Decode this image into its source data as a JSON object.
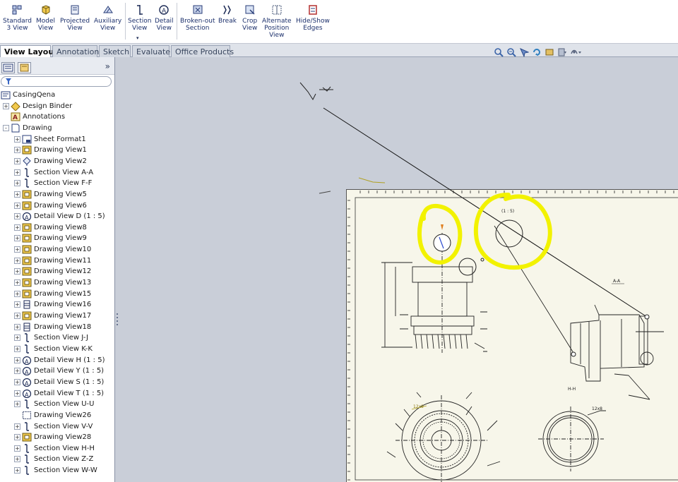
{
  "ribbon": {
    "buttons": [
      {
        "name": "standard-3-view-button",
        "line1": "Standard",
        "line2": "3 View",
        "line3": ""
      },
      {
        "name": "model-view-button",
        "line1": "Model",
        "line2": "View",
        "line3": ""
      },
      {
        "name": "projected-view-button",
        "line1": "Projected",
        "line2": "View",
        "line3": ""
      },
      {
        "name": "auxiliary-view-button",
        "line1": "Auxiliary",
        "line2": "View",
        "line3": ""
      },
      {
        "name": "section-view-button",
        "line1": "Section",
        "line2": "View",
        "line3": ""
      },
      {
        "name": "detail-view-button",
        "line1": "Detail",
        "line2": "View",
        "line3": ""
      },
      {
        "name": "broken-out-section-button",
        "line1": "Broken-out",
        "line2": "Section",
        "line3": ""
      },
      {
        "name": "break-button",
        "line1": "Break",
        "line2": "",
        "line3": ""
      },
      {
        "name": "crop-view-button",
        "line1": "Crop",
        "line2": "View",
        "line3": ""
      },
      {
        "name": "alternate-position-view-button",
        "line1": "Alternate",
        "line2": "Position",
        "line3": "View"
      },
      {
        "name": "hide-show-edges-button",
        "line1": "Hide/Show",
        "line2": "Edges",
        "line3": ""
      }
    ]
  },
  "tabs": [
    "View Layout",
    "Annotation",
    "Sketch",
    "Evaluate",
    "Office Products"
  ],
  "panel": {
    "expand_symbol": "»",
    "tree": [
      {
        "label": "CasingQena",
        "level": 0,
        "expander": "",
        "icon": "part-drawing-icon"
      },
      {
        "label": "Design Binder",
        "level": 1,
        "expander": "+",
        "icon": "design-binder-icon"
      },
      {
        "label": "Annotations",
        "level": 1,
        "expander": "",
        "icon": "annotations-icon"
      },
      {
        "label": "Drawing",
        "level": 1,
        "expander": "-",
        "icon": "sheet-icon"
      },
      {
        "label": "Sheet Format1",
        "level": 2,
        "expander": "+",
        "icon": "sheet-format-icon"
      },
      {
        "label": "Drawing View1",
        "level": 2,
        "expander": "+",
        "icon": "drawing-view-icon"
      },
      {
        "label": "Drawing View2",
        "level": 2,
        "expander": "+",
        "icon": "projected-view-icon"
      },
      {
        "label": "Section View A-A",
        "level": 2,
        "expander": "+",
        "icon": "section-view-icon"
      },
      {
        "label": "Section View F-F",
        "level": 2,
        "expander": "+",
        "icon": "section-view-icon"
      },
      {
        "label": "Drawing View5",
        "level": 2,
        "expander": "+",
        "icon": "drawing-view-icon"
      },
      {
        "label": "Drawing View6",
        "level": 2,
        "expander": "+",
        "icon": "drawing-view-icon"
      },
      {
        "label": "Detail View D (1 : 5)",
        "level": 2,
        "expander": "+",
        "icon": "detail-view-icon"
      },
      {
        "label": "Drawing View8",
        "level": 2,
        "expander": "+",
        "icon": "drawing-view-icon"
      },
      {
        "label": "Drawing View9",
        "level": 2,
        "expander": "+",
        "icon": "drawing-view-icon"
      },
      {
        "label": "Drawing View10",
        "level": 2,
        "expander": "+",
        "icon": "drawing-view-icon"
      },
      {
        "label": "Drawing View11",
        "level": 2,
        "expander": "+",
        "icon": "drawing-view-icon"
      },
      {
        "label": "Drawing View12",
        "level": 2,
        "expander": "+",
        "icon": "drawing-view-icon"
      },
      {
        "label": "Drawing View13",
        "level": 2,
        "expander": "+",
        "icon": "drawing-view-icon"
      },
      {
        "label": "Drawing View15",
        "level": 2,
        "expander": "+",
        "icon": "drawing-view-icon"
      },
      {
        "label": "Drawing View16",
        "level": 2,
        "expander": "+",
        "icon": "table-view-icon"
      },
      {
        "label": "Drawing View17",
        "level": 2,
        "expander": "+",
        "icon": "drawing-view-icon"
      },
      {
        "label": "Drawing View18",
        "level": 2,
        "expander": "+",
        "icon": "table-view-icon"
      },
      {
        "label": "Section View J-J",
        "level": 2,
        "expander": "+",
        "icon": "section-view-icon"
      },
      {
        "label": "Section View K-K",
        "level": 2,
        "expander": "+",
        "icon": "section-view-icon"
      },
      {
        "label": "Detail View H (1 : 5)",
        "level": 2,
        "expander": "+",
        "icon": "detail-view-icon"
      },
      {
        "label": "Detail View Y (1 : 5)",
        "level": 2,
        "expander": "+",
        "icon": "detail-view-icon"
      },
      {
        "label": "Detail View S (1 : 5)",
        "level": 2,
        "expander": "+",
        "icon": "detail-view-icon"
      },
      {
        "label": "Detail View T (1 : 5)",
        "level": 2,
        "expander": "+",
        "icon": "detail-view-icon"
      },
      {
        "label": "Section View U-U",
        "level": 2,
        "expander": "+",
        "icon": "section-view-icon"
      },
      {
        "label": "Drawing View26",
        "level": 2,
        "expander": "",
        "icon": "empty-view-icon"
      },
      {
        "label": "Section View V-V",
        "level": 2,
        "expander": "+",
        "icon": "section-view-icon"
      },
      {
        "label": "Drawing View28",
        "level": 2,
        "expander": "+",
        "icon": "drawing-view-icon"
      },
      {
        "label": "Section View H-H",
        "level": 2,
        "expander": "+",
        "icon": "section-view-icon"
      },
      {
        "label": "Section View Z-Z",
        "level": 2,
        "expander": "+",
        "icon": "section-view-icon"
      },
      {
        "label": "Section View W-W",
        "level": 2,
        "expander": "+",
        "icon": "section-view-icon"
      }
    ]
  },
  "drawing": {
    "label_aa": "A-A",
    "label_hh": "H-H",
    "label_cc": "(1 : 5)",
    "dim_12x8": "12x8",
    "dim_12x9": "12x9",
    "dim_top": "3ю11"
  },
  "colors": {
    "accent": "#1b2f6b",
    "canvas": "#c9ced8",
    "sheet": "#f7f6ea",
    "highlight": "#f2f200"
  }
}
